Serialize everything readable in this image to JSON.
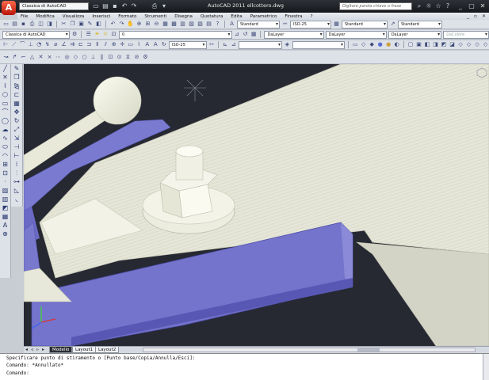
{
  "window": {
    "app_title": "AutoCAD 2011   ellcottero.dwg",
    "app_button_glyph": "A",
    "workspace": "Classica di AutoCAD",
    "search_placeholder": "Digitare parola chiave o frase",
    "controls": [
      "_",
      "▢",
      "✕"
    ]
  },
  "menu": {
    "items": [
      "File",
      "Modifica",
      "Visualizza",
      "Inserisci",
      "Formato",
      "Strumenti",
      "Disegna",
      "Quotatura",
      "Edita",
      "Parametrico",
      "Finestra",
      "?"
    ],
    "tail": [
      "_",
      "▫",
      "✕"
    ]
  },
  "toolbar_row1": {
    "text_style": "Standard",
    "dim_style": "ISO-25",
    "table_style": "Standard",
    "mleader_style": "Standard"
  },
  "toolbar_row2": {
    "workspace": "Classica di AutoCAD",
    "layer": "0",
    "color": "DaLayer",
    "linetype": "DaLayer",
    "lineweight": "DaLayer",
    "plot_style": "DaColore"
  },
  "toolbar_row3": {
    "dim_style": "ISO-25"
  },
  "layout_tabs": {
    "nav": [
      "◂",
      "◃",
      "▹",
      "▸"
    ],
    "tabs": [
      "Modello",
      "Layout1",
      "Layout2"
    ],
    "active": "Modello"
  },
  "command_line": {
    "lines": [
      "Specificare punto di stiramento o [Punto base/Copia/Annulla/Esci]:",
      "Comando: *Annullato*",
      "Comando:"
    ]
  },
  "viewcube_label": "⬡"
}
